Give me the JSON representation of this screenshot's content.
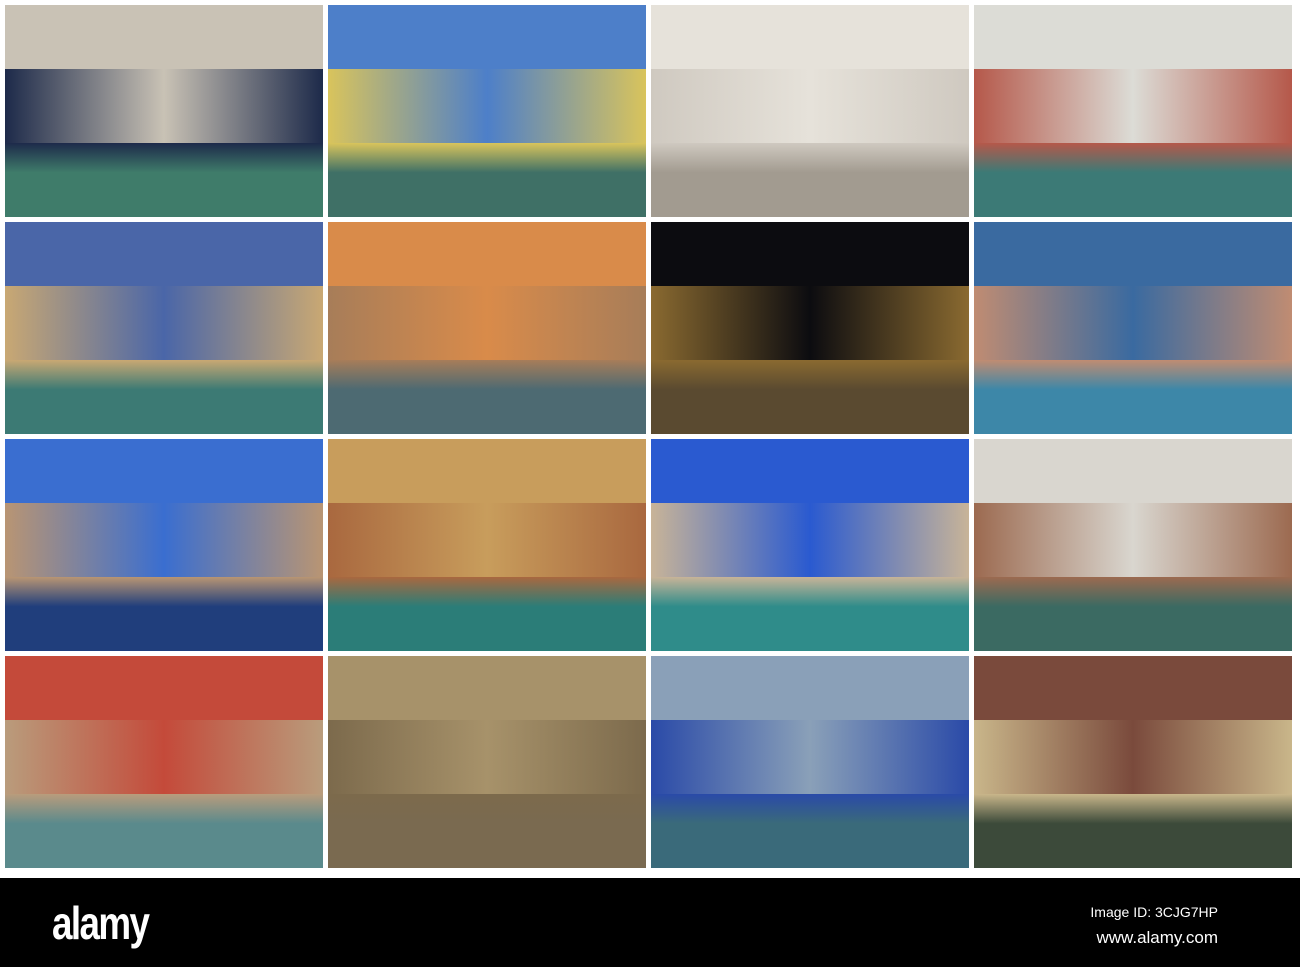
{
  "tiles": [
    {
      "sky": "#c9c2b5",
      "bld": "#1d2a4a",
      "wat": "#3f7c6a"
    },
    {
      "sky": "#4d7fc9",
      "bld": "#d9c45c",
      "wat": "#3f7066"
    },
    {
      "sky": "#e6e2da",
      "bld": "#cfc9c0",
      "wat": "#a29b90"
    },
    {
      "sky": "#dcdcd6",
      "bld": "#b5584a",
      "wat": "#3c7a76"
    },
    {
      "sky": "#4a66a8",
      "bld": "#c9a873",
      "wat": "#3c7a74"
    },
    {
      "sky": "#d98b4a",
      "bld": "#a77d59",
      "wat": "#4d6a72"
    },
    {
      "sky": "#0c0c10",
      "bld": "#8a6a30",
      "wat": "#5a4a30"
    },
    {
      "sky": "#3a6aa0",
      "bld": "#c08c72",
      "wat": "#3d87a8"
    },
    {
      "sky": "#3a6ed0",
      "bld": "#b99573",
      "wat": "#203e7c"
    },
    {
      "sky": "#c89d5c",
      "bld": "#a9683f",
      "wat": "#2b7d78"
    },
    {
      "sky": "#2a5ad0",
      "bld": "#c8b498",
      "wat": "#2f8c8a"
    },
    {
      "sky": "#d9d6cf",
      "bld": "#9c6a50",
      "wat": "#3b6a62"
    },
    {
      "sky": "#c44a3a",
      "bld": "#b99c7c",
      "wat": "#5a8a8c"
    },
    {
      "sky": "#a7926a",
      "bld": "#7c6a4c",
      "wat": "#7a6a50"
    },
    {
      "sky": "#8aa0b8",
      "bld": "#2a4aa8",
      "wat": "#3a6a7a"
    },
    {
      "sky": "#7a4a3c",
      "bld": "#c9b68a",
      "wat": "#3c4a3a"
    }
  ],
  "watermark": {
    "logo": "alamy",
    "image_id": "Image ID: 3CJG7HP",
    "site": "www.alamy.com"
  }
}
